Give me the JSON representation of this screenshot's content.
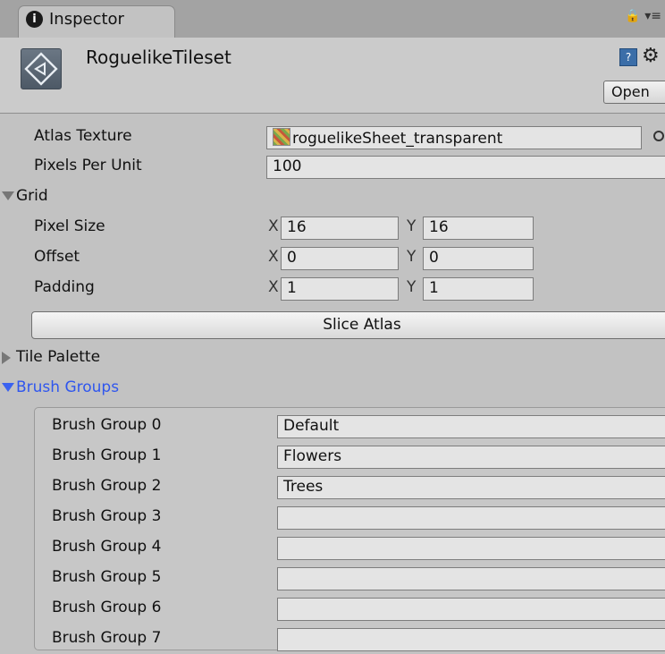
{
  "tab": {
    "icon": "info-icon",
    "label": "Inspector"
  },
  "header": {
    "icon": "unity-asset-icon",
    "title": "RoguelikeTileset",
    "help_icon": "help-book-icon",
    "settings_icon": "gear-icon",
    "open_label": "Open"
  },
  "fields": {
    "atlas_texture": {
      "label": "Atlas Texture",
      "value": "roguelikeSheet_transparent"
    },
    "pixels_per_unit": {
      "label": "Pixels Per Unit",
      "value": "100"
    }
  },
  "grid": {
    "label": "Grid",
    "x_label": "X",
    "y_label": "Y",
    "pixel_size": {
      "label": "Pixel Size",
      "x": "16",
      "y": "16"
    },
    "offset": {
      "label": "Offset",
      "x": "0",
      "y": "0"
    },
    "padding": {
      "label": "Padding",
      "x": "1",
      "y": "1"
    }
  },
  "slice_button": "Slice Atlas",
  "tile_palette": {
    "label": "Tile Palette"
  },
  "brush_groups": {
    "label": "Brush Groups",
    "items": [
      {
        "label": "Brush Group 0",
        "value": "Default"
      },
      {
        "label": "Brush Group 1",
        "value": "Flowers"
      },
      {
        "label": "Brush Group 2",
        "value": "Trees"
      },
      {
        "label": "Brush Group 3",
        "value": ""
      },
      {
        "label": "Brush Group 4",
        "value": ""
      },
      {
        "label": "Brush Group 5",
        "value": ""
      },
      {
        "label": "Brush Group 6",
        "value": ""
      },
      {
        "label": "Brush Group 7",
        "value": ""
      }
    ]
  },
  "colors": {
    "accent_blue": "#2f56ee",
    "panel_bg": "#c2c2c2",
    "field_bg": "#e4e4e4"
  }
}
